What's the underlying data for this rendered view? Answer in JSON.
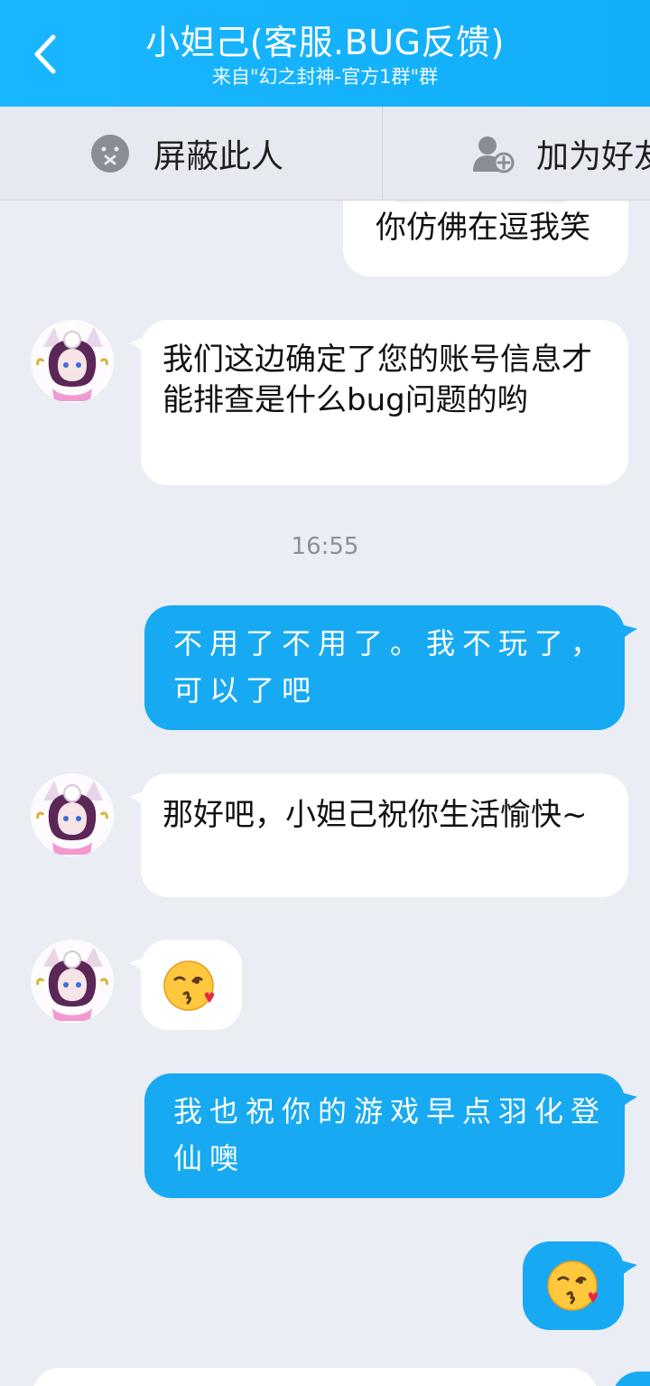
{
  "header": {
    "back_label": "<",
    "title": "小妲己(客服.BUG反馈)",
    "subtitle": "来自\"幻之封神-官方1群\"群"
  },
  "actions": {
    "block_label": "屏蔽此人",
    "add_friend_label": "加为好友"
  },
  "messages": {
    "m0": "你仿佛在逗我笑",
    "m1": "我们这边确定了您的账号信息才能排查是什么bug问题的哟",
    "time": "16:55",
    "m2": "不用了不用了。我不玩了，可以了吧",
    "m3": "那好吧，小妲己祝你生活愉快~",
    "m5": "我也祝你的游戏早点羽化登仙噢"
  },
  "colors": {
    "header_bg": "#12aef9",
    "outgoing_bubble": "#17aaf2",
    "incoming_bubble": "#ffffff",
    "chat_bg": "#eaedf4"
  },
  "icons": {
    "back": "chevron-left-icon",
    "block": "block-face-icon",
    "add_friend": "add-user-icon",
    "kiss_emoji": "face-blowing-kiss-emoji"
  }
}
